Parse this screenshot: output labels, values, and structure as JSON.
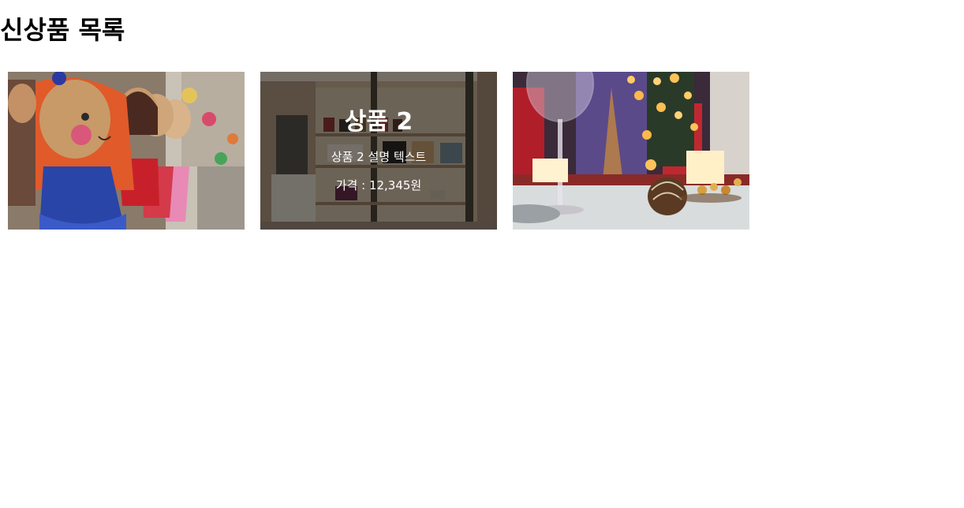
{
  "page": {
    "title": "신상품 목록"
  },
  "products": [
    {
      "title": "",
      "description": "",
      "price": "",
      "image": "knitted-dolls"
    },
    {
      "title": "상품 2",
      "description": "상품 2 설명 텍스트",
      "price": "가격 : 12,345원",
      "image": "handbag-store"
    },
    {
      "title": "",
      "description": "",
      "price": "",
      "image": "christmas-table"
    }
  ]
}
